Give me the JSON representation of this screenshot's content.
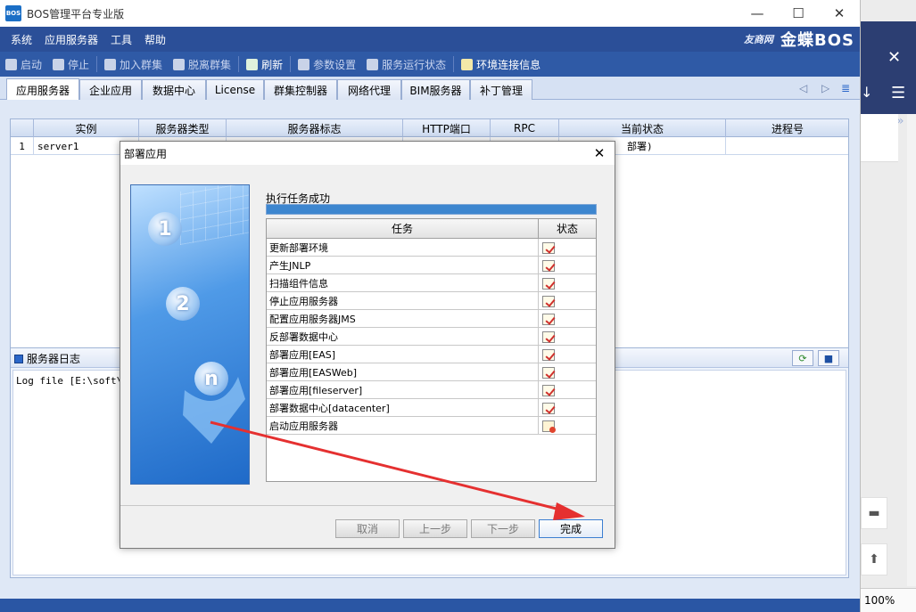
{
  "window": {
    "title": "BOS管理平台专业版",
    "logo": "BOS"
  },
  "menu": [
    "系统",
    "应用服务器",
    "工具",
    "帮助"
  ],
  "brand": {
    "partner": "友商网",
    "name": "金蝶BOS"
  },
  "toolbar": [
    {
      "label": "启动",
      "enabled": false
    },
    {
      "label": "停止",
      "enabled": false
    },
    {
      "label": "加入群集",
      "enabled": false
    },
    {
      "label": "脱离群集",
      "enabled": false
    },
    {
      "label": "刷新",
      "enabled": true
    },
    {
      "label": "参数设置",
      "enabled": false
    },
    {
      "label": "服务运行状态",
      "enabled": false
    },
    {
      "label": "环境连接信息",
      "enabled": true
    }
  ],
  "tabs": [
    "应用服务器",
    "企业应用",
    "数据中心",
    "License",
    "群集控制器",
    "网络代理",
    "BIM服务器",
    "补丁管理"
  ],
  "active_tab": "应用服务器",
  "server_table": {
    "columns": [
      "",
      "实例",
      "服务器类型",
      "服务器标志",
      "HTTP端口",
      "RPC",
      "当前状态",
      "进程号"
    ],
    "rows": [
      [
        "1",
        "server1",
        "",
        "",
        "",
        "",
        "部署)",
        ""
      ]
    ]
  },
  "log": {
    "title": "服务器日志",
    "text": "Log file [E:\\soft\\Ki"
  },
  "dialog": {
    "title": "部署应用",
    "status_label": "执行任务成功",
    "progress": 1.0,
    "columns": [
      "任务",
      "状态"
    ],
    "tasks": [
      {
        "name": "更新部署环境",
        "state": "done"
      },
      {
        "name": "产生JNLP",
        "state": "done"
      },
      {
        "name": "扫描组件信息",
        "state": "done"
      },
      {
        "name": "停止应用服务器",
        "state": "done"
      },
      {
        "name": "配置应用服务器JMS",
        "state": "done"
      },
      {
        "name": "反部署数据中心",
        "state": "done"
      },
      {
        "name": "部署应用[EAS]",
        "state": "done"
      },
      {
        "name": "部署应用[EASWeb]",
        "state": "done"
      },
      {
        "name": "部署应用[fileserver]",
        "state": "done"
      },
      {
        "name": "部署数据中心[datacenter]",
        "state": "done"
      },
      {
        "name": "启动应用服务器",
        "state": "running"
      }
    ],
    "steps": [
      "1",
      "2",
      "n"
    ],
    "buttons": {
      "cancel": "取消",
      "prev": "上一步",
      "next": "下一步",
      "finish": "完成"
    }
  },
  "right_app": {
    "zoom": "100%"
  }
}
